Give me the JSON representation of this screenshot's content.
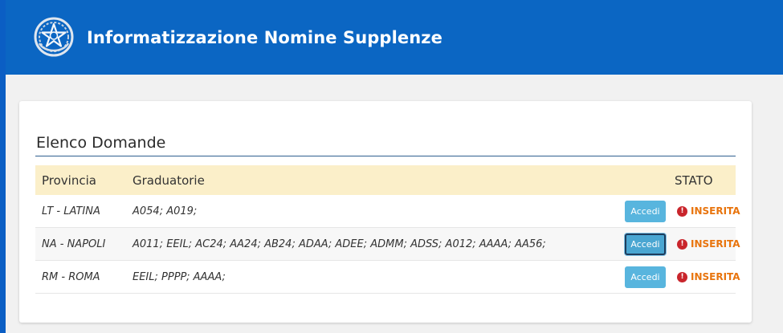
{
  "header": {
    "title": "Informatizzazione Nomine Supplenze",
    "emblem_icon": "italian-republic-emblem-icon",
    "background_color": "#0b66c3"
  },
  "card": {
    "title": "Elenco Domande"
  },
  "table": {
    "columns": {
      "provincia": "Provincia",
      "graduatorie": "Graduatorie",
      "stato": "STATO"
    },
    "rows": [
      {
        "provincia": "LT - LATINA",
        "graduatorie": "A054; A019;",
        "action_label": "Accedi",
        "stato": "INSERITA",
        "status_icon": "alert-circle-icon"
      },
      {
        "provincia": "NA - NAPOLI",
        "graduatorie": "A011; EEIL; AC24; AA24; AB24; ADAA; ADEE; ADMM; ADSS; A012; AAAA; AA56;",
        "action_label": "Accedi",
        "stato": "INSERITA",
        "status_icon": "alert-circle-icon"
      },
      {
        "provincia": "RM - ROMA",
        "graduatorie": "EEIL; PPPP; AAAA;",
        "action_label": "Accedi",
        "stato": "INSERITA",
        "status_icon": "alert-circle-icon"
      }
    ]
  },
  "colors": {
    "button": "#58b5de",
    "status_text": "#e8740d",
    "status_icon": "#c9252c",
    "table_header": "#fbefc9"
  }
}
